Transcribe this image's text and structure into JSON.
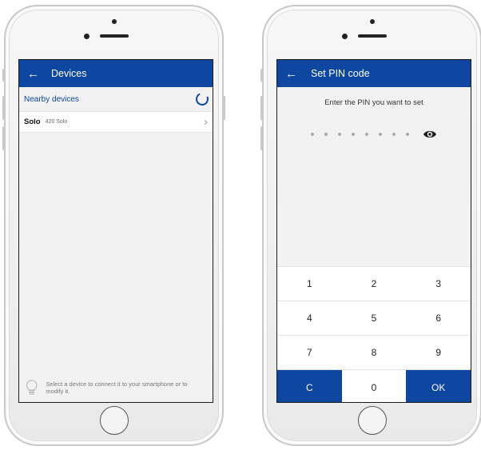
{
  "devices_screen": {
    "title": "Devices",
    "section_label": "Nearby devices",
    "device": {
      "name": "Solo",
      "model": "420 Solo"
    },
    "hint_text": "Select a device to connect it to your smartphone or to modify it.",
    "icons": {
      "back": "back-arrow-icon",
      "spinner": "loading-spinner-icon",
      "chevron": "chevron-right-icon",
      "bulb": "lightbulb-icon"
    }
  },
  "pin_screen": {
    "title": "Set PIN code",
    "prompt": "Enter the PIN you want to set",
    "pin_length": 8,
    "keys": [
      [
        "1",
        "2",
        "3"
      ],
      [
        "4",
        "5",
        "6"
      ],
      [
        "7",
        "8",
        "9"
      ],
      [
        "C",
        "0",
        "OK"
      ]
    ],
    "icons": {
      "back": "back-arrow-icon",
      "eye": "eye-icon"
    }
  },
  "colors": {
    "primary": "#0d47a1",
    "screen_bg": "#f2f2f2"
  }
}
